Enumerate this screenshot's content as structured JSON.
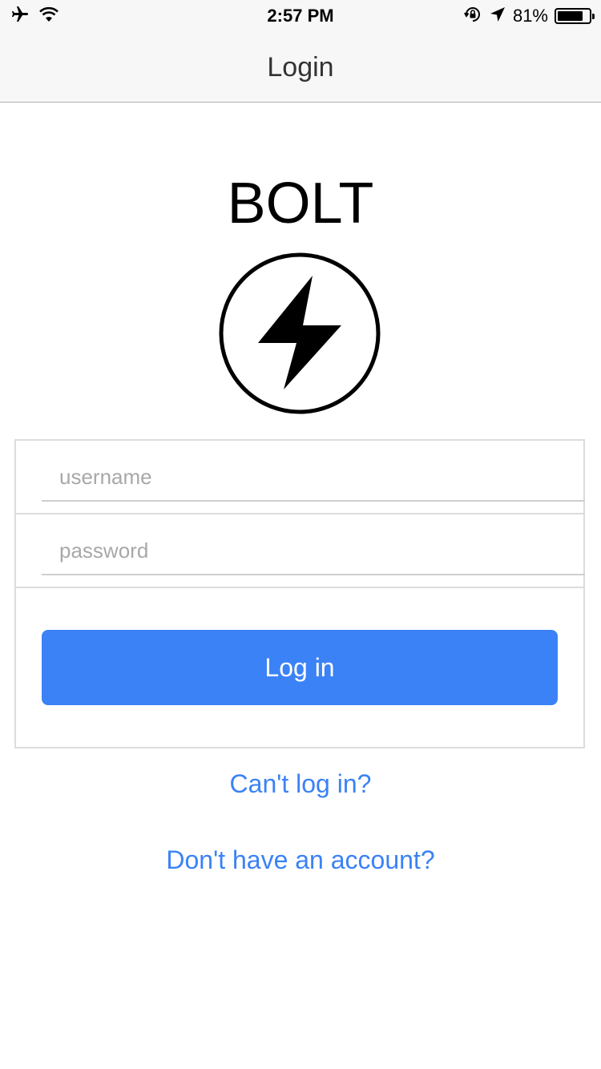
{
  "status_bar": {
    "time": "2:57 PM",
    "battery_percent": "81%",
    "battery_level": 0.81,
    "icons": [
      "airplane-icon",
      "wifi-icon",
      "rotation-lock-icon",
      "location-arrow-icon",
      "battery-icon"
    ]
  },
  "nav": {
    "title": "Login"
  },
  "brand": {
    "title": "BOLT",
    "logo_icon": "lightning-bolt-icon"
  },
  "form": {
    "username_placeholder": "username",
    "username_value": "",
    "password_placeholder": "password",
    "password_value": "",
    "login_label": "Log in"
  },
  "links": {
    "cant_login": "Can't log in?",
    "no_account": "Don't have an account?"
  },
  "colors": {
    "accent": "#3b82f6",
    "nav_background": "#f7f7f7",
    "border": "#dcdcdc"
  }
}
